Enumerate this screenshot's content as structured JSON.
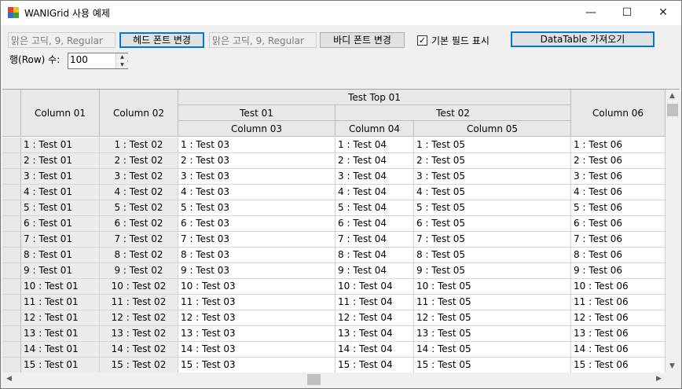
{
  "window": {
    "title": "WANIGrid 사용 예제",
    "minimize": "—",
    "maximize": "☐",
    "close": "✕"
  },
  "toolbar": {
    "head_font_value": "맑은 고딕, 9, Regular",
    "head_font_button": "헤드 폰트 변경",
    "body_font_value": "맑은 고딕, 9, Regular",
    "body_font_button": "바디 폰트 변경",
    "checkbox_label": "기본 필드 표시",
    "checkbox_checked": true,
    "datatable_button": "DataTable 가져오기",
    "row_count_label": "행(Row) 수:",
    "row_count_value": "100"
  },
  "grid": {
    "top_header": "Test Top 01",
    "group_headers": [
      "Test 01",
      "Test 02"
    ],
    "columns": [
      "Column 01",
      "Column 02",
      "Column 03",
      "Column 04",
      "Column 05",
      "Column 06"
    ],
    "rows": [
      [
        "1 : Test 01",
        "1 : Test 02",
        "1 : Test 03",
        "1 : Test 04",
        "1 : Test 05",
        "1 : Test 06"
      ],
      [
        "2 : Test 01",
        "2 : Test 02",
        "2 : Test 03",
        "2 : Test 04",
        "2 : Test 05",
        "2 : Test 06"
      ],
      [
        "3 : Test 01",
        "3 : Test 02",
        "3 : Test 03",
        "3 : Test 04",
        "3 : Test 05",
        "3 : Test 06"
      ],
      [
        "4 : Test 01",
        "4 : Test 02",
        "4 : Test 03",
        "4 : Test 04",
        "4 : Test 05",
        "4 : Test 06"
      ],
      [
        "5 : Test 01",
        "5 : Test 02",
        "5 : Test 03",
        "5 : Test 04",
        "5 : Test 05",
        "5 : Test 06"
      ],
      [
        "6 : Test 01",
        "6 : Test 02",
        "6 : Test 03",
        "6 : Test 04",
        "6 : Test 05",
        "6 : Test 06"
      ],
      [
        "7 : Test 01",
        "7 : Test 02",
        "7 : Test 03",
        "7 : Test 04",
        "7 : Test 05",
        "7 : Test 06"
      ],
      [
        "8 : Test 01",
        "8 : Test 02",
        "8 : Test 03",
        "8 : Test 04",
        "8 : Test 05",
        "8 : Test 06"
      ],
      [
        "9 : Test 01",
        "9 : Test 02",
        "9 : Test 03",
        "9 : Test 04",
        "9 : Test 05",
        "9 : Test 06"
      ],
      [
        "10 : Test 01",
        "10 : Test 02",
        "10 : Test 03",
        "10 : Test 04",
        "10 : Test 05",
        "10 : Test 06"
      ],
      [
        "11 : Test 01",
        "11 : Test 02",
        "11 : Test 03",
        "11 : Test 04",
        "11 : Test 05",
        "11 : Test 06"
      ],
      [
        "12 : Test 01",
        "12 : Test 02",
        "12 : Test 03",
        "12 : Test 04",
        "12 : Test 05",
        "12 : Test 06"
      ],
      [
        "13 : Test 01",
        "13 : Test 02",
        "13 : Test 03",
        "13 : Test 04",
        "13 : Test 05",
        "13 : Test 06"
      ],
      [
        "14 : Test 01",
        "14 : Test 02",
        "14 : Test 03",
        "14 : Test 04",
        "14 : Test 05",
        "14 : Test 06"
      ],
      [
        "15 : Test 01",
        "15 : Test 02",
        "15 : Test 03",
        "15 : Test 04",
        "15 : Test 05",
        "15 : Test 06"
      ]
    ]
  },
  "scroll": {
    "up": "▲",
    "down": "▼",
    "left": "◀",
    "right": "▶"
  },
  "colors": {
    "accent": "#0078d7",
    "header_bg": "#e8e8e8",
    "grid_line": "#d5d5d5"
  }
}
